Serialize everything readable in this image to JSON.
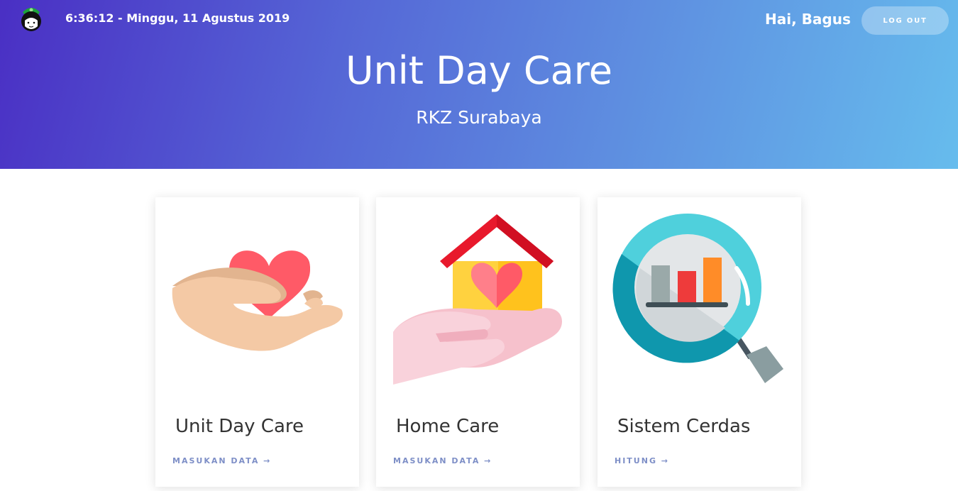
{
  "header": {
    "datetime": "6:36:12 - Minggu, 11 Agustus 2019",
    "greeting": "Hai, Bagus",
    "logout_label": "LOG OUT",
    "title": "Unit Day Care",
    "subtitle": "RKZ Surabaya",
    "gradient_start": "#4a2fc4",
    "gradient_end": "#66bced"
  },
  "cards": [
    {
      "title": "Unit Day Care",
      "link": "MASUKAN DATA →",
      "icon": "hand-heart-icon"
    },
    {
      "title": "Home Care",
      "link": "MASUKAN DATA →",
      "icon": "hand-house-icon"
    },
    {
      "title": "Sistem Cerdas",
      "link": "HITUNG →",
      "icon": "magnifier-chart-icon"
    }
  ],
  "colors": {
    "link": "#7e8fc7",
    "heart": "#ff5a67",
    "roof": "#e8192c",
    "house": "#ffd23f",
    "lens": "#0f97ad"
  }
}
